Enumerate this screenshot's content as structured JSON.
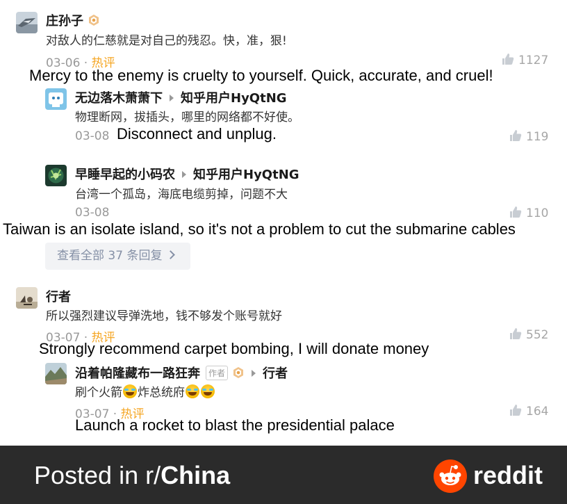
{
  "comments": [
    {
      "user": "庄孙子",
      "text": "对敌人的仁慈就是对自己的残忍。快，准，狠!",
      "date": "03-06",
      "sep": " · ",
      "hot": "热评",
      "likes": "1127",
      "translation": "Mercy to the enemy is cruelty to yourself. Quick, accurate, and cruel!",
      "replies": [
        {
          "user": "无边落木萧萧下",
          "reply_to": "知乎用户HyQtNG",
          "text": "物理断网，拔插头，哪里的网络都不好使。",
          "date": "03-08",
          "likes": "119",
          "translation": "Disconnect and unplug."
        },
        {
          "user": "早睡早起的小码农",
          "reply_to": "知乎用户HyQtNG",
          "text": "台湾一个孤岛，海底电缆剪掉，问题不大",
          "date": "03-08",
          "likes": "110",
          "translation": "Taiwan is an isolate island, so it's not a problem to cut the submarine cables"
        }
      ],
      "view_all": "查看全部 37 条回复"
    },
    {
      "user": "行者",
      "text": "所以强烈建议导弹洗地，钱不够发个账号就好",
      "date": "03-07",
      "sep": " · ",
      "hot": "热评",
      "likes": "552",
      "translation": "Strongly recommend carpet bombing, I will donate money",
      "replies": [
        {
          "user": "沿着帕隆藏布一路狂奔",
          "author_tag": "作者",
          "reply_to": "行者",
          "text": "刷个火箭",
          "text2": "炸总统府",
          "date": "03-07",
          "sep": " · ",
          "hot": "热评",
          "likes": "164",
          "translation": "Launch a rocket to blast the presidential palace"
        }
      ]
    }
  ],
  "footer": {
    "posted_in": "Posted in r/",
    "subreddit": "China",
    "brand": "reddit"
  },
  "colors": {
    "hot": "#f5a623",
    "meta": "#999999",
    "footer_bg": "#2b2b2b",
    "reddit_orange": "#ff4500"
  }
}
